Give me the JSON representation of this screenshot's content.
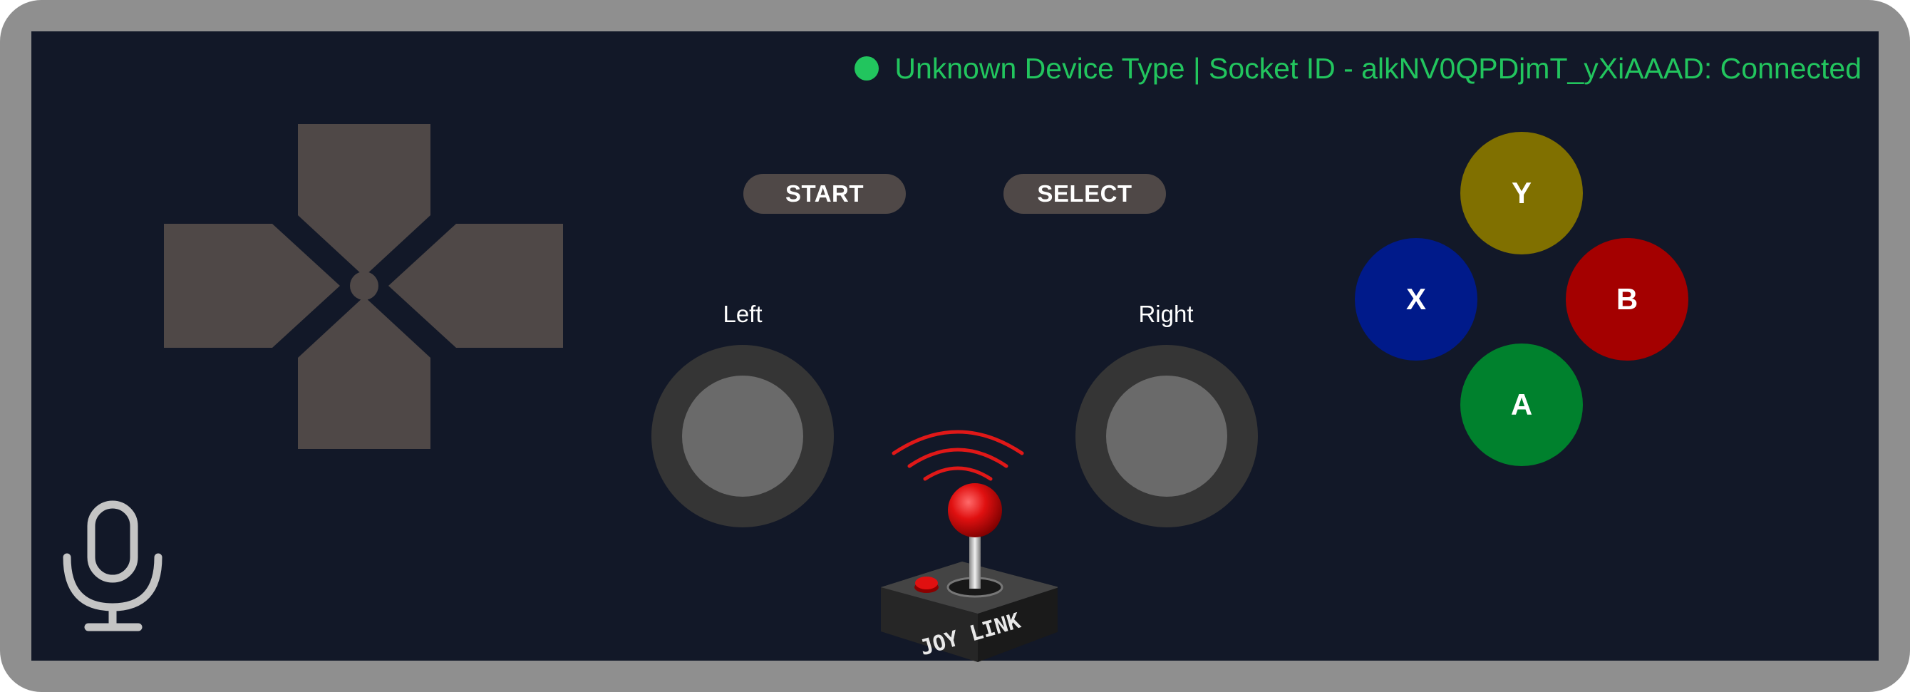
{
  "status": {
    "device_type": "Unknown Device Type",
    "separator": "|",
    "socket_label": "Socket ID - alkNV0QPDjmT_yXiAAAD: Connected",
    "color": "#22c55e"
  },
  "center_buttons": {
    "start_label": "START",
    "select_label": "SELECT"
  },
  "sticks": {
    "left_label": "Left",
    "right_label": "Right"
  },
  "face_buttons": {
    "y": {
      "label": "Y",
      "color": "#807000"
    },
    "x": {
      "label": "X",
      "color": "#001a8a"
    },
    "b": {
      "label": "B",
      "color": "#a40000"
    },
    "a": {
      "label": "A",
      "color": "#00812d"
    }
  },
  "dpad": {
    "color": "#4f4847"
  },
  "logo": {
    "text": "JOY LINK"
  },
  "icons": {
    "microphone": "microphone-icon",
    "status": "status-dot-icon"
  }
}
